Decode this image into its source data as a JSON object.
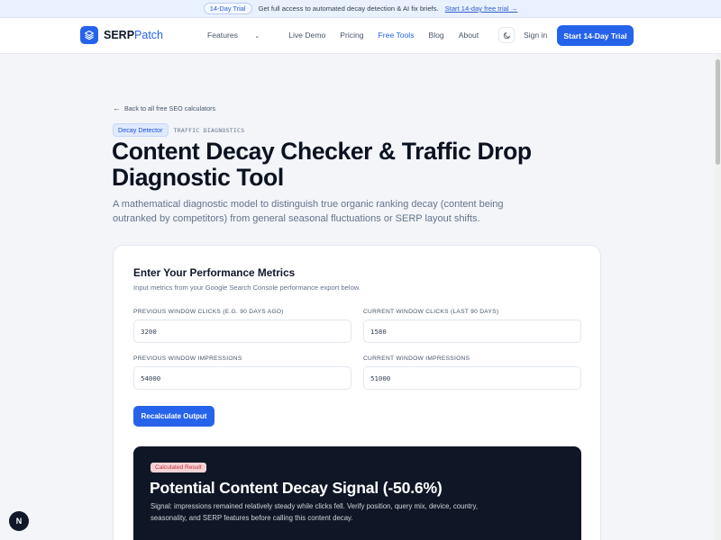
{
  "banner": {
    "badge": "14-Day Trial",
    "message": "Get full access to automated decay detection & AI fix briefs.",
    "link": "Start 14-day free trial →"
  },
  "header": {
    "logo": {
      "name_main": "SERP",
      "name_accent": "Patch"
    },
    "nav": [
      {
        "label": "Features",
        "icon": "chevron-down-icon"
      },
      {
        "label": "Live Demo"
      },
      {
        "label": "Pricing"
      },
      {
        "label": "Free Tools",
        "active": true
      },
      {
        "label": "Blog"
      },
      {
        "label": "About"
      }
    ],
    "theme_icon": "moon-icon",
    "signin": "Sign in",
    "cta": "Start 14-Day Trial"
  },
  "page": {
    "back_link": "Back to all free SEO calculators",
    "tag": "Decay Detector",
    "tag_meta": "TRAFFIC DIAGNOSTICS",
    "title": "Content Decay Checker & Traffic Drop Diagnostic Tool",
    "subtitle": "A mathematical diagnostic model to distinguish true organic ranking decay (content being outranked by competitors) from general seasonal fluctuations or SERP layout shifts."
  },
  "form": {
    "title": "Enter Your Performance Metrics",
    "description": "Input metrics from your Google Search Console performance export below.",
    "fields": [
      {
        "label": "Previous window clicks (e.g. 90 days ago)",
        "value": "3200"
      },
      {
        "label": "Current window clicks (last 90 days)",
        "value": "1580"
      },
      {
        "label": "Previous window impressions",
        "value": "54000"
      },
      {
        "label": "Current window impressions",
        "value": "51000"
      }
    ],
    "button": "Recalculate Output"
  },
  "result": {
    "badge": "Calculated Result",
    "title": "Potential Content Decay Signal (-50.6%)",
    "text": "Signal: impressions remained relatively steady while clicks fell. Verify position, query mix, device, country, seasonality, and SERP features before calling this content decay."
  },
  "fab": {
    "label": "N"
  },
  "colors": {
    "primary": "#2563eb",
    "result_bg": "#0f1726",
    "badge_red": "#c92d38"
  }
}
